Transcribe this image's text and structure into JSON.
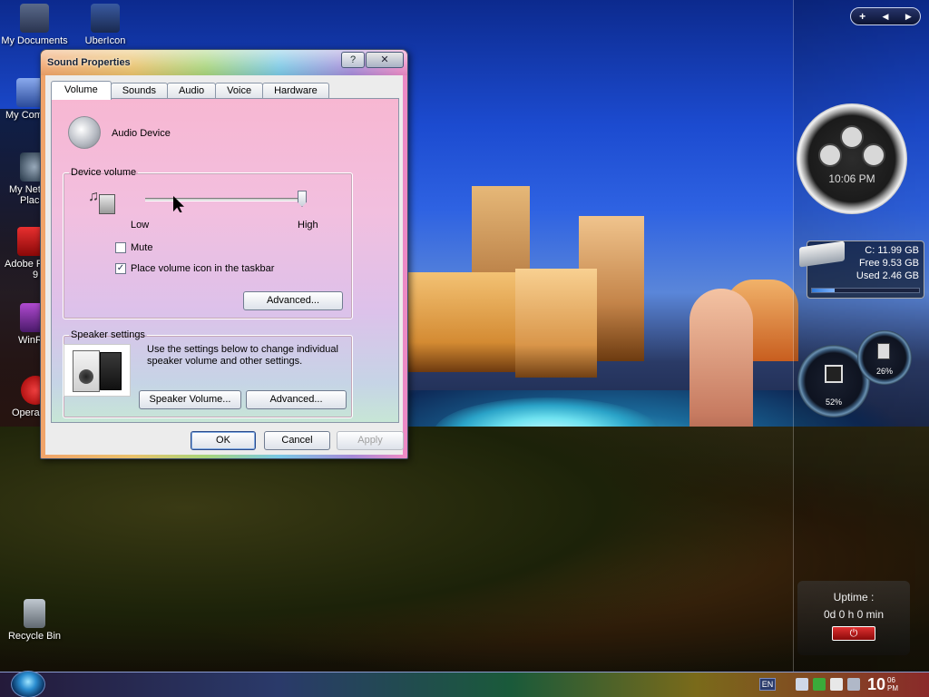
{
  "desktop": {
    "icons": [
      {
        "label": "My Documents",
        "color": "#3a4a6a"
      },
      {
        "label": "UberIcon",
        "color": "#2a4a8a"
      },
      {
        "label": "My Com",
        "color": "#4a6aaa"
      },
      {
        "label": "My Net",
        "label2": "Plac",
        "color": "#3a4a5a"
      },
      {
        "label": "Adobe R",
        "label2": "9",
        "color": "#c01818"
      },
      {
        "label": "WinR",
        "color": "#6a2a8a"
      },
      {
        "label": "Opera",
        "color": "#d81818"
      },
      {
        "label": "Recycle Bin",
        "color": "#7a8a9a"
      }
    ]
  },
  "sidebar": {
    "controls": {
      "add": "+",
      "prev": "◀",
      "next": "▶"
    },
    "clock": {
      "time": "10:06 PM"
    },
    "drive": {
      "label": "C:  11.99 GB",
      "free": "Free 9.53 GB",
      "used": "Used 2.46 GB",
      "used_fraction": 0.21
    },
    "cpu_gauge": {
      "value": "52%"
    },
    "mem_gauge": {
      "value": "26%"
    },
    "uptime": {
      "label": "Uptime :",
      "value": "0d 0 h 0 min",
      "power_icon": "power-icon"
    }
  },
  "taskbar": {
    "language": "EN",
    "clock": {
      "hour": "10",
      "minute": "06",
      "ampm": "PM"
    }
  },
  "dialog": {
    "title": "Sound Properties",
    "help_label": "?",
    "close_label": "✕",
    "tabs": [
      {
        "label": "Volume",
        "active": true
      },
      {
        "label": "Sounds",
        "active": false
      },
      {
        "label": "Audio",
        "active": false
      },
      {
        "label": "Voice",
        "active": false
      },
      {
        "label": "Hardware",
        "active": false
      }
    ],
    "volume": {
      "device_name": "Audio Device",
      "device_volume_legend": "Device volume",
      "low_label": "Low",
      "high_label": "High",
      "volume_level": 1.0,
      "mute_label": "Mute",
      "mute_checked": false,
      "tray_icon_label": "Place volume icon in the taskbar",
      "tray_icon_checked": true,
      "advanced_label": "Advanced...",
      "speaker_legend": "Speaker settings",
      "speaker_text": "Use the settings below to change individual speaker volume and other settings.",
      "speaker_volume_label": "Speaker Volume...",
      "speaker_advanced_label": "Advanced..."
    },
    "buttons": {
      "ok": "OK",
      "cancel": "Cancel",
      "apply": "Apply"
    }
  }
}
